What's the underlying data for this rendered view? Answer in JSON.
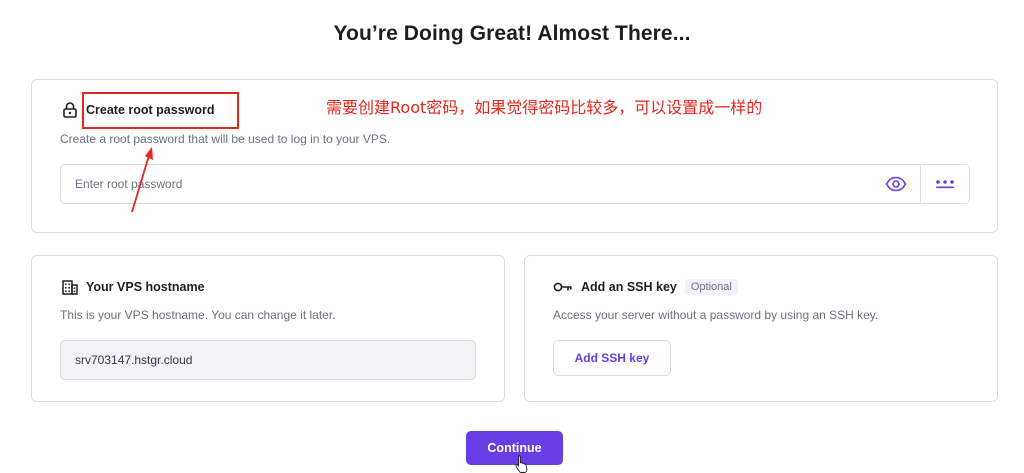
{
  "page": {
    "title": "You’re Doing Great! Almost There..."
  },
  "root_password": {
    "heading": "Create root password",
    "description": "Create a root password that will be used to log in to your VPS.",
    "placeholder": "Enter root password",
    "value": "",
    "icons": {
      "lock": "lock-icon",
      "show": "eye-icon",
      "generate": "dots-icon"
    }
  },
  "hostname": {
    "heading": "Your VPS hostname",
    "description": "This is your VPS hostname. You can change it later.",
    "value": "srv703147.hstgr.cloud",
    "icon": "building-icon"
  },
  "ssh": {
    "heading": "Add an SSH key",
    "badge": "Optional",
    "description": "Access your server without a password by using an SSH key.",
    "button_label": "Add SSH key",
    "icon": "key-icon"
  },
  "footer": {
    "continue_label": "Continue"
  },
  "annotation": {
    "note": "需要创建Root密码，如果觉得密码比较多，可以设置成一样的",
    "color": "#e8261c"
  },
  "colors": {
    "accent": "#673de6",
    "border": "#dadce0",
    "muted": "#6d7081"
  }
}
